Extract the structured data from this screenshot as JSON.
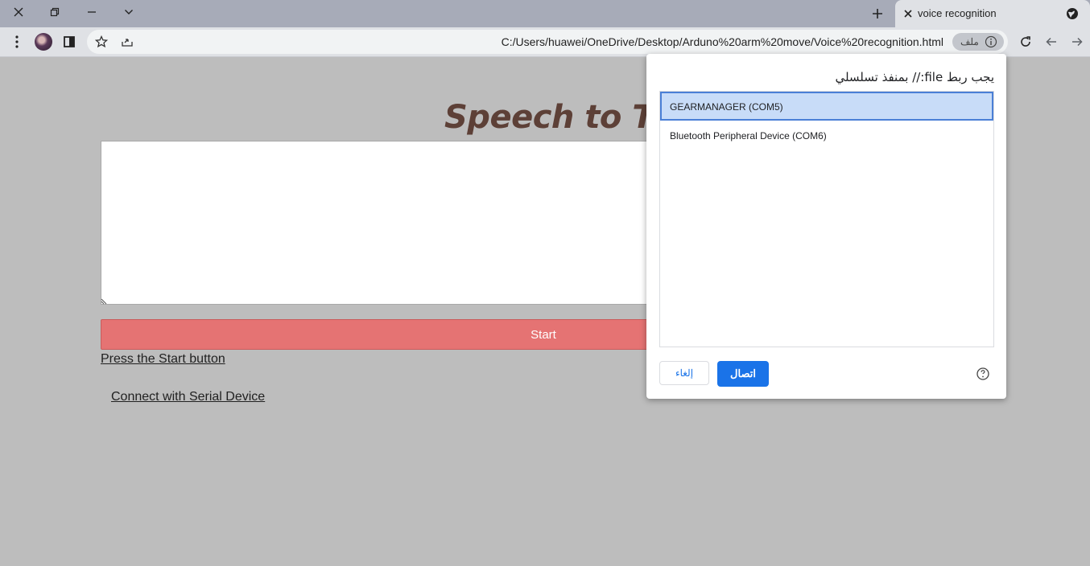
{
  "browser": {
    "tab": {
      "title": "voice recognition"
    },
    "address_bar": {
      "scheme_chip": "ملف",
      "url": "C:/Users/huawei/OneDrive/Desktop/Arduno%20arm%20move/Voice%20recognition.html"
    },
    "icons": {
      "window_controls": [
        "close-icon",
        "restore-icon",
        "minimize-icon",
        "chevron-down-icon"
      ],
      "toolbar_left": [
        "menu-dots-icon",
        "profile-avatar",
        "side-panel-icon",
        "star-icon",
        "share-icon"
      ],
      "toolbar_right": [
        "reload-icon",
        "back-icon",
        "forward-icon"
      ]
    }
  },
  "page": {
    "title": "Speech to Text",
    "textarea_value": "",
    "start_button": "Start",
    "hint": "Press the Start button",
    "serial_link": "Connect with Serial Device"
  },
  "serial_dialog": {
    "heading": "يجب ربط file:// بمنفذ تسلسلي",
    "ports": [
      {
        "label": "GEARMANAGER (COM5)",
        "selected": true
      },
      {
        "label": "Bluetooth Peripheral Device (COM6)",
        "selected": false
      }
    ],
    "cancel_label": "إلغاء",
    "connect_label": "اتصال"
  },
  "colors": {
    "tabstrip": "#a7abb8",
    "page_background": "#bdbdbd",
    "title_color": "#5d4037",
    "start_button": "#e57373",
    "selected_port": "#c8dcf8",
    "primary_blue": "#1a73e8"
  }
}
